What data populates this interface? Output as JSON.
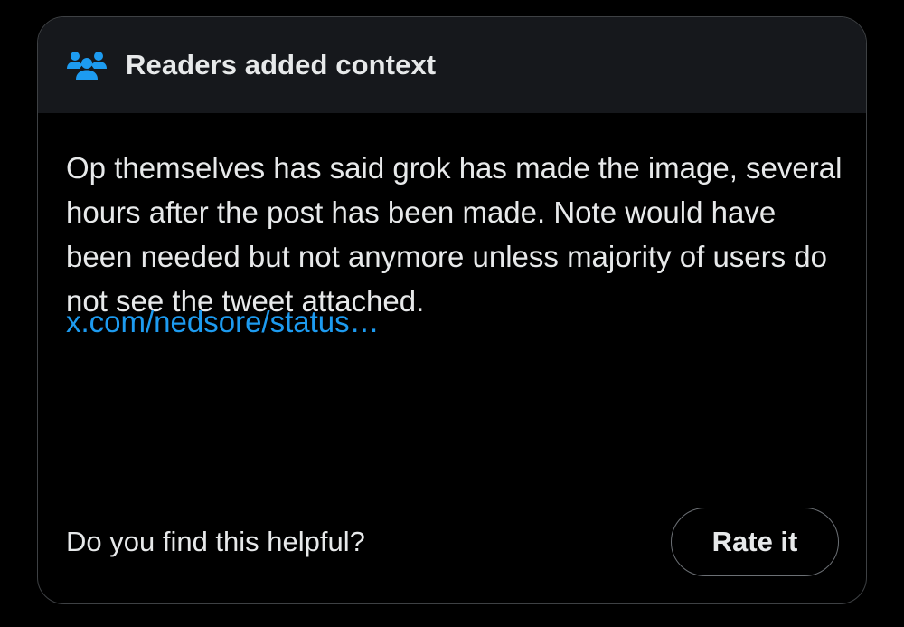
{
  "header": {
    "title": "Readers added context",
    "icon": "people-group-icon",
    "icon_color": "#1d9bf0"
  },
  "note": {
    "text": "Op themselves has said grok has made the image, several hours after the post has been made. Note would have been needed but not anymore unless majority of users do not see the tweet attached.",
    "link_text": "x.com/nedsore/status…"
  },
  "footer": {
    "question": "Do you find this helpful?",
    "rate_button_label": "Rate it"
  },
  "colors": {
    "background": "#000000",
    "header_background": "#16181c",
    "text": "#e7e9ea",
    "link": "#1d9bf0",
    "border": "#3e4144"
  }
}
